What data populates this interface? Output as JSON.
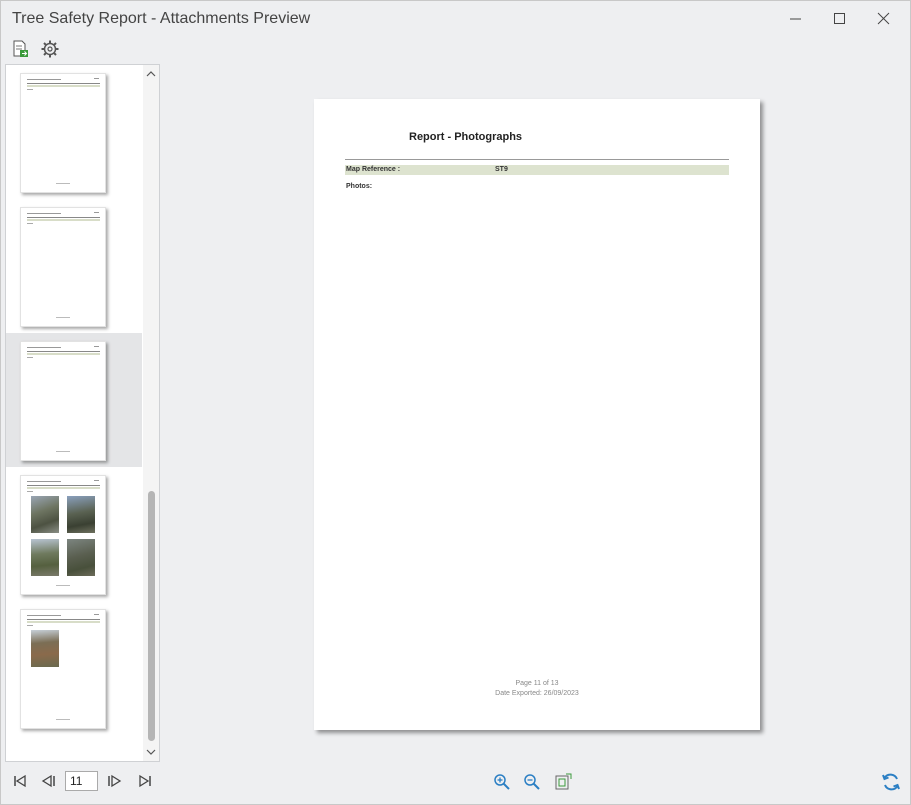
{
  "window": {
    "title": "Tree Safety Report - Attachments Preview"
  },
  "toolbar": {
    "icons": [
      "export-report-icon",
      "settings-gear-icon"
    ]
  },
  "thumbnails": [
    {
      "kind": "text-page"
    },
    {
      "kind": "text-page"
    },
    {
      "kind": "text-page",
      "selected": true
    },
    {
      "kind": "photo-page",
      "photos": 4
    },
    {
      "kind": "photo-page",
      "photos": 1
    }
  ],
  "preview": {
    "heading": "Report - Photographs",
    "map_reference_label": "Map Reference :",
    "map_reference_value": "ST9",
    "photos_label": "Photos:",
    "footer_page": "Page 11 of 13",
    "footer_date": "Date Exported: 26/09/2023"
  },
  "navigation": {
    "current_page": "11"
  },
  "colors": {
    "accent": "#2b7fc4",
    "band": "#dde3cf"
  }
}
